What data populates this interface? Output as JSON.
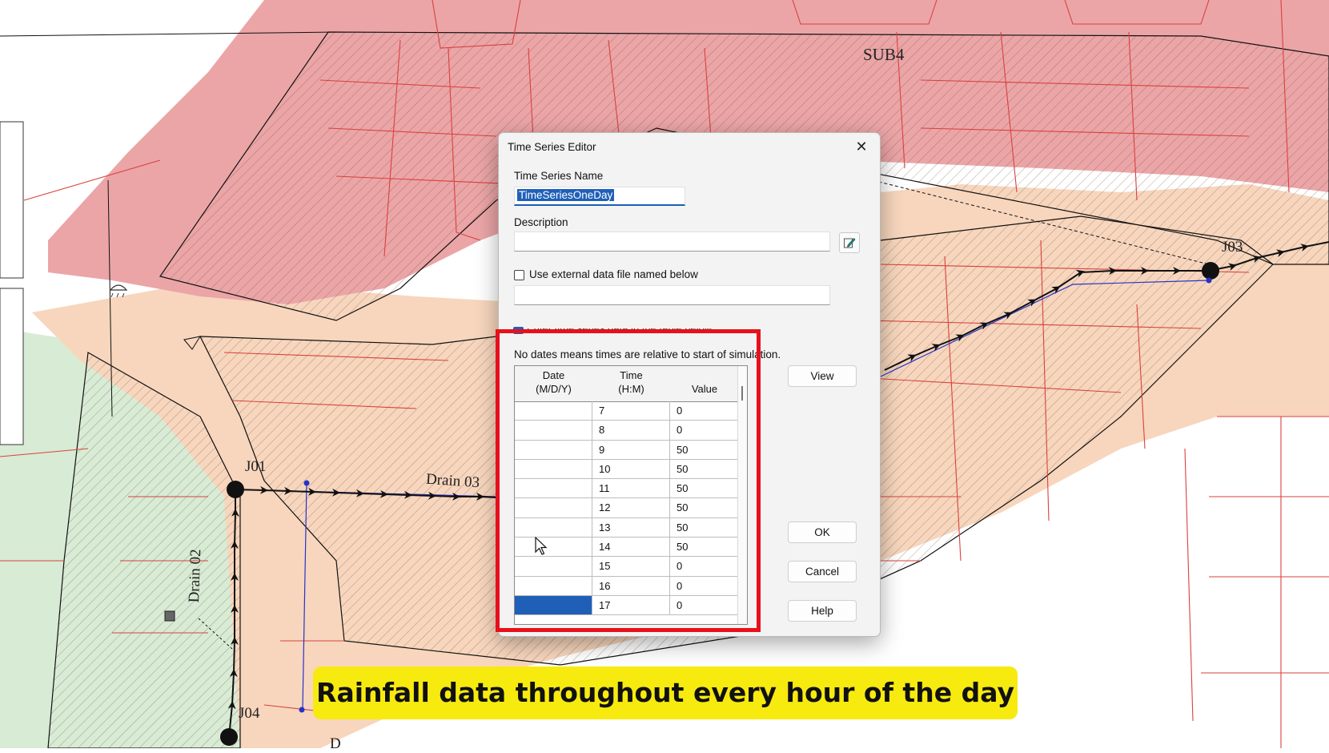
{
  "map": {
    "labels": {
      "sub4": "SUB4",
      "j01": "J01",
      "j03": "J03",
      "j04": "J04",
      "drain03": "Drain 03",
      "drain02": "Drain 02",
      "d_partial": "D"
    },
    "colors": {
      "red_zone": "#eba5a7",
      "orange_zone": "#f7d6bd",
      "green_zone": "#d8ebd4",
      "parcel_line": "#d9413f",
      "conduit": "#111111",
      "conduit_blue": "#2633c9"
    }
  },
  "dialog": {
    "title": "Time Series Editor",
    "close_icon": "close-icon",
    "name_label": "Time Series Name",
    "name_value": "TimeSeriesOneDay",
    "description_label": "Description",
    "description_value": "",
    "edit_icon": "pencil-edit-icon",
    "use_external_label": "Use external data file named below",
    "use_external_checked": false,
    "external_file_value": "",
    "enter_table_label": "Enter time series data in the table below",
    "enter_table_checked": true,
    "note": "No dates means times are relative to start of simulation.",
    "table": {
      "headers": {
        "date_line1": "Date",
        "date_line2": "(M/D/Y)",
        "time_line1": "Time",
        "time_line2": "(H:M)",
        "value": "Value"
      },
      "rows": [
        {
          "date": "",
          "time": "7",
          "value": "0"
        },
        {
          "date": "",
          "time": "8",
          "value": "0"
        },
        {
          "date": "",
          "time": "9",
          "value": "50"
        },
        {
          "date": "",
          "time": "10",
          "value": "50"
        },
        {
          "date": "",
          "time": "11",
          "value": "50"
        },
        {
          "date": "",
          "time": "12",
          "value": "50"
        },
        {
          "date": "",
          "time": "13",
          "value": "50"
        },
        {
          "date": "",
          "time": "14",
          "value": "50"
        },
        {
          "date": "",
          "time": "15",
          "value": "0"
        },
        {
          "date": "",
          "time": "16",
          "value": "0"
        },
        {
          "date": "",
          "time": "17",
          "value": "0"
        }
      ],
      "selected_row": 10
    },
    "buttons": {
      "view": "View",
      "ok": "OK",
      "cancel": "Cancel",
      "help": "Help"
    }
  },
  "overlay": {
    "highlight_color": "#e8101a",
    "caption": "Rainfall data throughout every hour of the day",
    "caption_bg": "#f7ea0f"
  }
}
